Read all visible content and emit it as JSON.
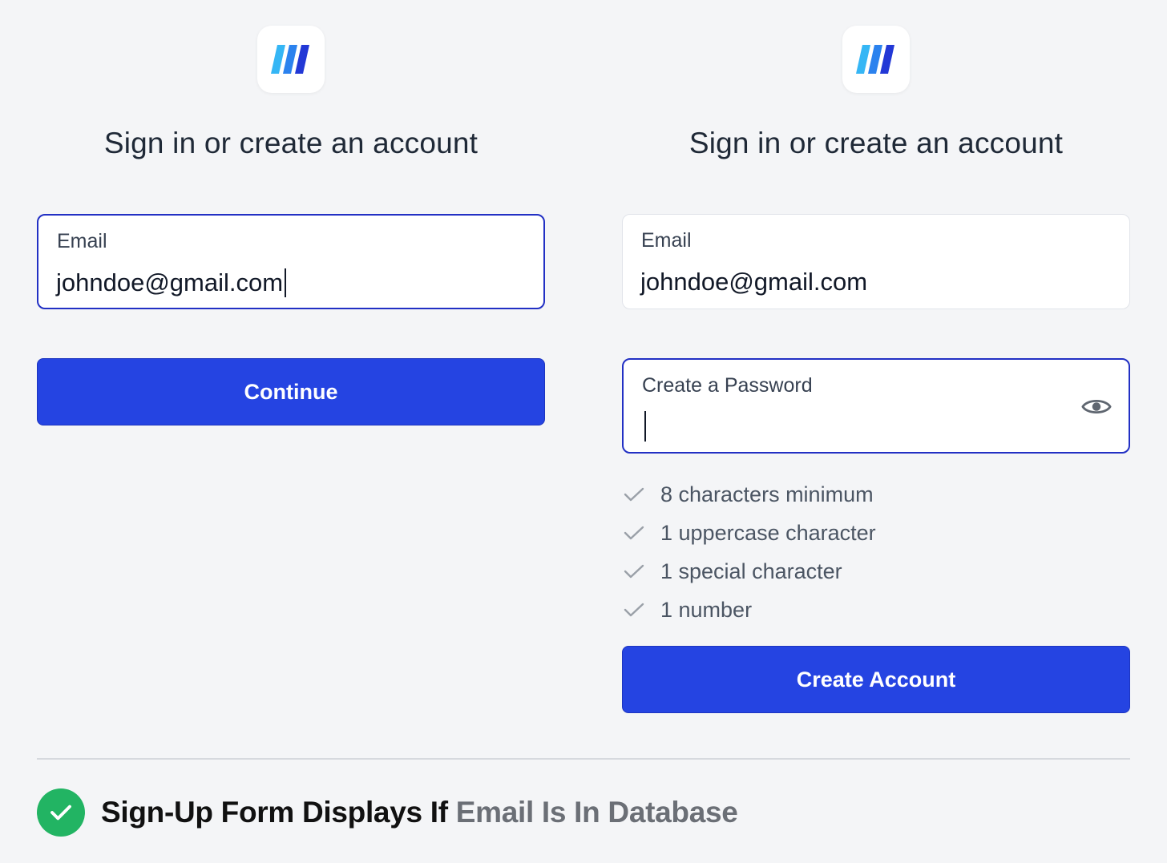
{
  "colors": {
    "background": "#f4f5f7",
    "primary_button": "#2544e2",
    "focus_border": "#2230c4",
    "success": "#22b463",
    "logo_light": "#35b6f5",
    "logo_dark": "#2238d6"
  },
  "left_panel": {
    "logo": "app-logo-icon",
    "title": "Sign in or create an account",
    "email": {
      "label": "Email",
      "value": "johndoe@gmail.com",
      "focused": true
    },
    "continue_button": "Continue"
  },
  "right_panel": {
    "logo": "app-logo-icon",
    "title": "Sign in or create an account",
    "email": {
      "label": "Email",
      "value": "johndoe@gmail.com",
      "focused": false
    },
    "password": {
      "label": "Create a Password",
      "value": "",
      "focused": true,
      "toggle_icon": "eye-icon"
    },
    "requirements": [
      {
        "text": "8 characters minimum",
        "icon": "check-icon"
      },
      {
        "text": "1 uppercase character",
        "icon": "check-icon"
      },
      {
        "text": "1 special character",
        "icon": "check-icon"
      },
      {
        "text": "1 number",
        "icon": "check-icon"
      }
    ],
    "create_button": "Create Account"
  },
  "footer": {
    "icon": "check-circle-icon",
    "text_dark": "Sign-Up Form Displays If",
    "text_muted": "Email Is In Database"
  }
}
